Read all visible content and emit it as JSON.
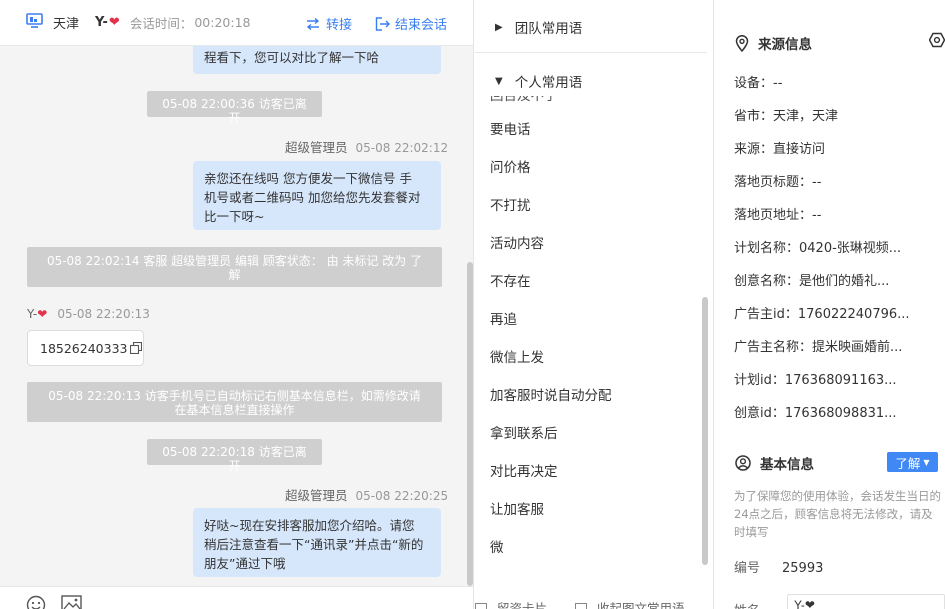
{
  "header": {
    "city": "天津",
    "visitor_name": "Y-",
    "heart": "❤",
    "time_label": "会话时间：",
    "time_value": "00:20:18",
    "transfer_label": "转接",
    "end_label": "结束会话"
  },
  "messages": {
    "b1": "程看下，您可以对比了解一下哈",
    "s1": "05-08 22:00:36 访客已离开",
    "m2_sender": "超级管理员",
    "m2_time": "05-08 22:02:12",
    "b2_line1": "亲您还在线吗 您方便发一下微信号 手",
    "b2_line2": "机号或者二维码吗 加您给您先发套餐对",
    "b2_line3": "比一下呀~",
    "s2_line1": "05-08 22:02:14 客服 超级管理员 编辑 顾客状态： 由 未标记 改为 了",
    "s2_line2": "解",
    "v_name": "Y-",
    "v_heart": "❤",
    "v_time": "05-08 22:20:13",
    "phone": "18526240333",
    "s3_line1": "05-08 22:20:13 访客手机号已自动标记右侧基本信息栏，如需修改请",
    "s3_line2": "在基本信息栏直接操作",
    "s4": "05-08 22:20:18 访客已离开",
    "m5_sender": "超级管理员",
    "m5_time": "05-08 22:20:25",
    "b5_line1": "好哒~现在安排客服加您介绍哈。请您",
    "b5_line2": "稍后注意查看一下“通讯录”并点击“新的",
    "b5_line3": "朋友”通过下哦"
  },
  "phrases": {
    "team_group": "团队常用语",
    "personal_group": "个人常用语",
    "partial_item": "回台及不了",
    "items": [
      "要电话",
      "问价格",
      "不打扰",
      "活动内容",
      "不存在",
      "再追",
      "微信上发",
      "加客服时说自动分配",
      "拿到联系后",
      "对比再决定",
      "让加客服",
      "微"
    ],
    "footer_left": "留资卡片",
    "footer_right": "收起图文常用语"
  },
  "info": {
    "source_title": "来源信息",
    "rows": [
      {
        "label": "设备：",
        "value": "--"
      },
      {
        "label": "省市：",
        "value": "天津，天津"
      },
      {
        "label": "来源：",
        "value": "直接访问"
      },
      {
        "label": "落地页标题：",
        "value": "--"
      },
      {
        "label": "落地页地址：",
        "value": "--"
      },
      {
        "label": "计划名称：",
        "value": "0420-张琳视频..."
      },
      {
        "label": "创意名称：",
        "value": "是他们的婚礼..."
      },
      {
        "label": "广告主id：",
        "value": "176022240796..."
      },
      {
        "label": "广告主名称：",
        "value": "提米映画婚前..."
      },
      {
        "label": "计划id：",
        "value": "176368091163..."
      },
      {
        "label": "创意id：",
        "value": "176368098831..."
      }
    ],
    "basic_title": "基本信息",
    "learn_label": "了解",
    "notice": "为了保障您的使用体验，会话发生当日的24点之后，顾客信息将无法修改，请及时填写",
    "serial_label": "编号",
    "serial_value": "25993",
    "name_label": "姓名",
    "name_value": "Y-❤"
  }
}
